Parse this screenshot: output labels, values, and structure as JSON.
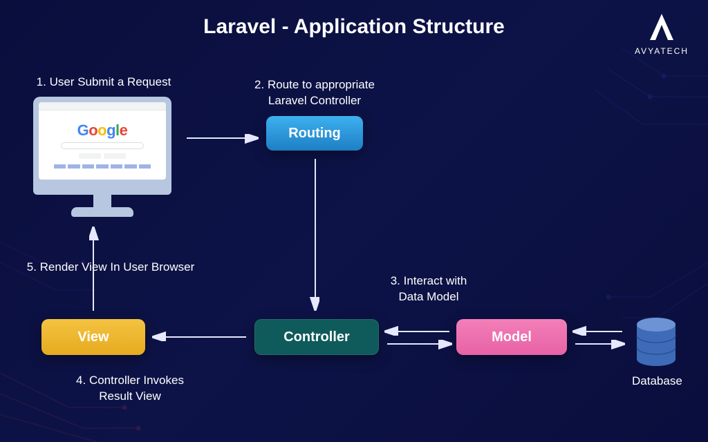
{
  "title": "Laravel - Application Structure",
  "brand": "AVYATECH",
  "steps": {
    "s1": "1. User Submit a Request",
    "s2_line1": "2. Route to appropriate",
    "s2_line2": "Laravel Controller",
    "s3_line1": "3. Interact with",
    "s3_line2": "Data Model",
    "s4_line1": "4. Controller Invokes",
    "s4_line2": "Result View",
    "s5": "5. Render View In User Browser"
  },
  "nodes": {
    "routing": "Routing",
    "controller": "Controller",
    "model": "Model",
    "view": "View"
  },
  "database_label": "Database",
  "google": {
    "g": "G",
    "o1": "o",
    "o2": "o",
    "g2": "g",
    "l": "l",
    "e": "e"
  }
}
